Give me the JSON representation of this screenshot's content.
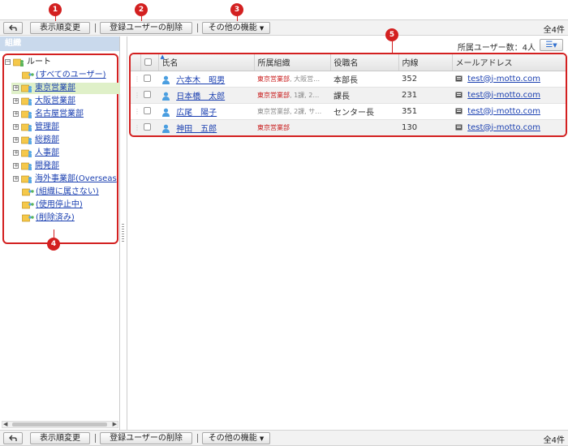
{
  "toolbar": {
    "back_icon": "back-arrow-icon",
    "display_order": "表示順変更",
    "delete_users": "登録ユーザーの削除",
    "other_functions": "その他の機能",
    "total_count": "全4件"
  },
  "markers": [
    "1",
    "2",
    "3",
    "4",
    "5"
  ],
  "sidebar": {
    "header": "組織",
    "root": "ルート",
    "items": [
      {
        "label": "(すべてのユーザー)",
        "icon": "user-group-icon"
      },
      {
        "label": "東京営業部",
        "icon": "org-folder-icon"
      },
      {
        "label": "大阪営業部",
        "icon": "org-folder-icon"
      },
      {
        "label": "名古屋営業部",
        "icon": "org-folder-icon"
      },
      {
        "label": "管理部",
        "icon": "org-folder-icon"
      },
      {
        "label": "総務部",
        "icon": "org-folder-icon"
      },
      {
        "label": "人事部",
        "icon": "org-folder-icon"
      },
      {
        "label": "開発部",
        "icon": "org-folder-icon"
      },
      {
        "label": "海外事業部(Overseas",
        "icon": "org-folder-icon"
      },
      {
        "label": "(組織に属さない)",
        "icon": "user-group-icon"
      },
      {
        "label": "(使用停止中)",
        "icon": "user-group-icon"
      },
      {
        "label": "(削除済み)",
        "icon": "user-group-icon"
      }
    ]
  },
  "main": {
    "member_count": "所属ユーザー数：4人",
    "columns": [
      "氏名",
      "所属組織",
      "役職名",
      "内線",
      "メールアドレス"
    ],
    "rows": [
      {
        "name": "六本木　昭男",
        "org_main": "東京営業部",
        "org_rest": ", 大阪営…",
        "title": "本部長",
        "ext": "352",
        "email": "test@j-motto.com"
      },
      {
        "name": "日本橋　太郎",
        "org_main": "東京営業部",
        "org_rest": ", 1課, 2…",
        "title": "課長",
        "ext": "231",
        "email": "test@j-motto.com"
      },
      {
        "name": "広尾　陽子",
        "org_main": "東京営業部",
        "org_rest": ", 2課, サ…",
        "title": "センター長",
        "ext": "351",
        "email": "test@j-motto.com"
      },
      {
        "name": "神田　五郎",
        "org_main": "東京営業部",
        "org_rest": "",
        "title": "",
        "ext": "130",
        "email": "test@j-motto.com"
      }
    ]
  },
  "colors": {
    "accent_red": "#d32020",
    "link_blue": "#1a3fb0",
    "selected_bg": "#dff0c8",
    "header_bg": "#c9d9ec"
  }
}
